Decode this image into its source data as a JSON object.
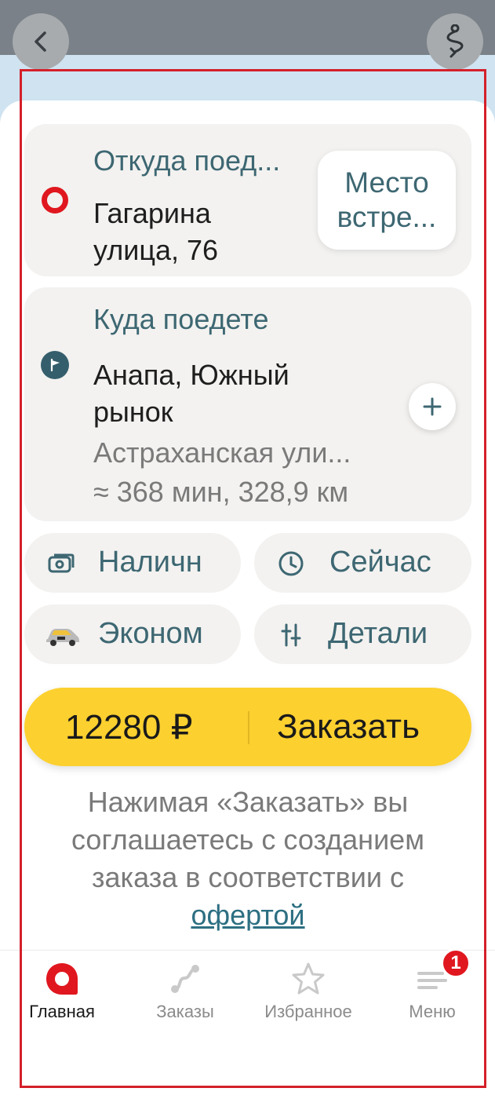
{
  "header": {
    "back_icon": "chevron-left-icon",
    "route_icon": "route-icon"
  },
  "from": {
    "label": "Откуда поед...",
    "address": "Гагарина улица, 76",
    "meet_button": "Место встре...",
    "pin_color": "#e0171f"
  },
  "to": {
    "label": "Куда поедете",
    "place": "Анапа, Южный рынок",
    "street": "Астраханская ули...",
    "eta": "≈ 368 мин, 328,9 км",
    "add_icon": "plus-icon"
  },
  "options": {
    "payment": "Наличн",
    "time": "Сейчас",
    "tariff": "Эконом",
    "details": "Детали"
  },
  "order": {
    "price": "12280 ₽",
    "button": "Заказать",
    "color": "#fcd02f"
  },
  "legal": {
    "text": "Нажимая «Заказать» вы соглашаетесь с созданием заказа в соответствии с",
    "link": "офертой"
  },
  "nav": {
    "home": "Главная",
    "orders": "Заказы",
    "favorites": "Избранное",
    "menu": "Меню",
    "menu_badge": "1"
  },
  "colors": {
    "accent": "#3d6772",
    "brand_red": "#e0171f",
    "card_bg": "#f3f2f0"
  }
}
